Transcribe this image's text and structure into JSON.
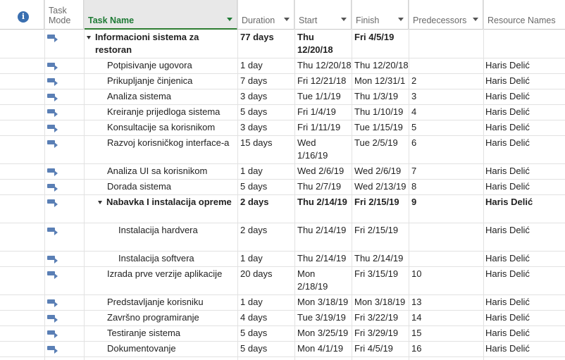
{
  "header": {
    "info_symbol": "i",
    "task_mode": "Task\nMode",
    "task_mode_line1": "Task",
    "task_mode_line2": "Mode",
    "task_name": "Task Name",
    "duration": "Duration",
    "start": "Start",
    "finish": "Finish",
    "predecessors": "Predecessors",
    "resource_names": "Resource Names"
  },
  "colors": {
    "accent_green": "#1e7a35",
    "mode_icon_blue": "#5a7fb5",
    "info_blue": "#3a6fb0"
  },
  "tasks": [
    {
      "name_line1": "Informacioni sistema za",
      "name_line2": "restoran",
      "duration": "77 days",
      "start_line1": "Thu",
      "start_line2": "12/20/18",
      "finish": "Fri 4/5/19",
      "pred": "",
      "res": "",
      "bold": true,
      "summary": true
    },
    {
      "name": "Potpisivanje ugovora",
      "duration": "1 day",
      "start": "Thu 12/20/18",
      "finish": "Thu 12/20/18",
      "pred": "",
      "res": "Haris Delić"
    },
    {
      "name": "Prikupljanje činjenica",
      "duration": "7 days",
      "start": "Fri 12/21/18",
      "finish": "Mon 12/31/1",
      "pred": "2",
      "res": "Haris Delić"
    },
    {
      "name": "Analiza sistema",
      "duration": "3 days",
      "start": "Tue 1/1/19",
      "finish": "Thu 1/3/19",
      "pred": "3",
      "res": "Haris Delić"
    },
    {
      "name": "Kreiranje prijedloga sistema",
      "duration": "5 days",
      "start": "Fri 1/4/19",
      "finish": "Thu 1/10/19",
      "pred": "4",
      "res": "Haris Delić"
    },
    {
      "name": "Konsultacije sa korisnikom",
      "duration": "3 days",
      "start": "Fri 1/11/19",
      "finish": "Tue 1/15/19",
      "pred": "5",
      "res": "Haris Delić"
    },
    {
      "name": "Razvoj korisničkog interface-a",
      "duration": "15 days",
      "start_line1": "Wed",
      "start_line2": "1/16/19",
      "finish": "Tue 2/5/19",
      "pred": "6",
      "res": "Haris Delić"
    },
    {
      "name": "Analiza UI sa korisnikom",
      "duration": "1 day",
      "start": "Wed 2/6/19",
      "finish": "Wed 2/6/19",
      "pred": "7",
      "res": "Haris Delić"
    },
    {
      "name": "Dorada sistema",
      "duration": "5 days",
      "start": "Thu 2/7/19",
      "finish": "Wed 2/13/19",
      "pred": "8",
      "res": "Haris Delić"
    },
    {
      "name": "Nabavka I instalacija opreme",
      "duration": "2 days",
      "start": "Thu 2/14/19",
      "finish": "Fri 2/15/19",
      "pred": "9",
      "res": "Haris Delić",
      "bold": true,
      "summary": true
    },
    {
      "name": "Instalacija hardvera",
      "duration": "2 days",
      "start": "Thu 2/14/19",
      "finish": "Fri 2/15/19",
      "pred": "",
      "res": "Haris Delić"
    },
    {
      "name": "Instalacija softvera",
      "duration": "1 day",
      "start": "Thu 2/14/19",
      "finish": "Thu 2/14/19",
      "pred": "",
      "res": "Haris Delić"
    },
    {
      "name": "Izrada prve verzije aplikacije",
      "duration": "20 days",
      "start_line1": "Mon",
      "start_line2": "2/18/19",
      "finish": "Fri 3/15/19",
      "pred": "10",
      "res": "Haris Delić"
    },
    {
      "name": "Predstavljanje korisniku",
      "duration": "1 day",
      "start": "Mon 3/18/19",
      "finish": "Mon 3/18/19",
      "pred": "13",
      "res": "Haris Delić"
    },
    {
      "name": "Završno programiranje",
      "duration": "4 days",
      "start": "Tue 3/19/19",
      "finish": "Fri 3/22/19",
      "pred": "14",
      "res": "Haris Delić"
    },
    {
      "name": "Testiranje sistema",
      "duration": "5 days",
      "start": "Mon 3/25/19",
      "finish": "Fri 3/29/19",
      "pred": "15",
      "res": "Haris Delić"
    },
    {
      "name": "Dokumentovanje",
      "duration": "5 days",
      "start": "Mon 4/1/19",
      "finish": "Fri 4/5/19",
      "pred": "16",
      "res": "Haris Delić"
    }
  ]
}
